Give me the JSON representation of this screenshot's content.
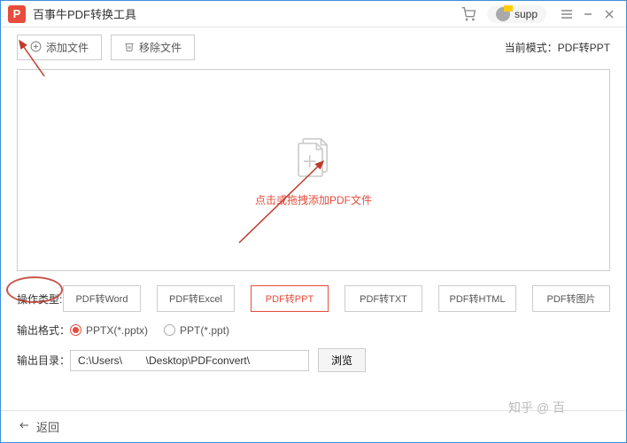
{
  "titlebar": {
    "logo_letter": "P",
    "title": "百事牛PDF转换工具",
    "user_label": "supp"
  },
  "toolbar": {
    "add_file": "添加文件",
    "remove_file": "移除文件",
    "mode_label_prefix": "当前模式：",
    "mode_value": "PDF转PPT"
  },
  "dropzone": {
    "hint": "点击或拖拽添加PDF文件"
  },
  "operation_type": {
    "label": "操作类型:",
    "options": [
      "PDF转Word",
      "PDF转Excel",
      "PDF转PPT",
      "PDF转TXT",
      "PDF转HTML",
      "PDF转图片"
    ],
    "active_index": 2
  },
  "output_format": {
    "label": "输出格式：",
    "options": [
      "PPTX(*.pptx)",
      "PPT(*.ppt)"
    ],
    "selected_index": 0
  },
  "output_dir": {
    "label": "输出目录：",
    "path": "C:\\Users\\        \\Desktop\\PDFconvert\\",
    "browse": "浏览"
  },
  "footer": {
    "back": "返回"
  },
  "watermark": {
    "text": "知乎 @ 百"
  }
}
